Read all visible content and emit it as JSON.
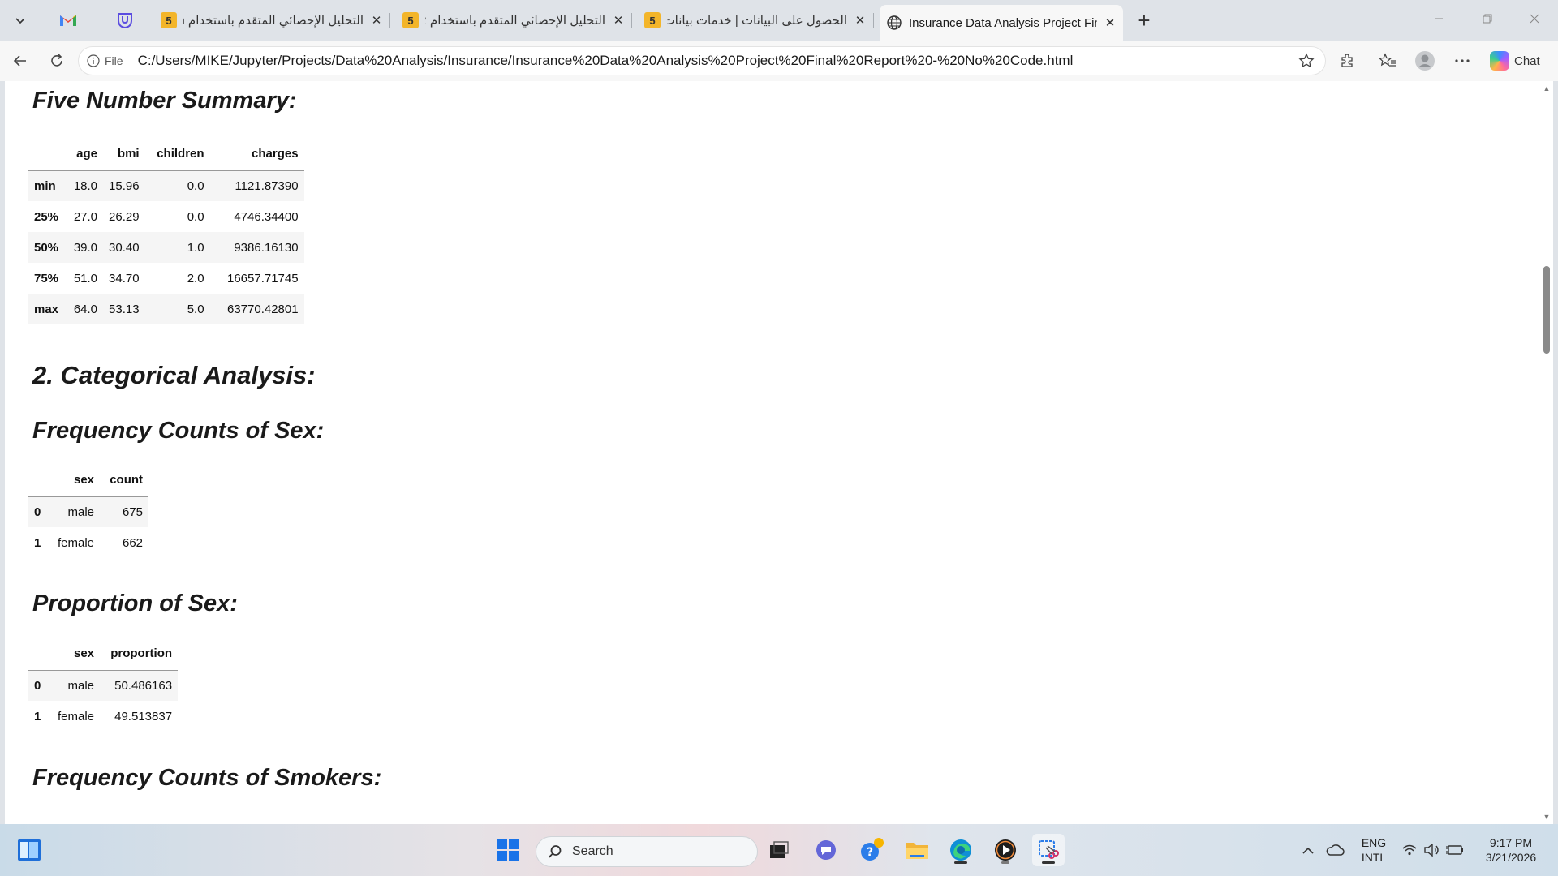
{
  "browser": {
    "tabs": [
      {
        "title": "التحليل الإحصائي المتقدم باستخدام n",
        "favicon": "5",
        "active": false
      },
      {
        "title": "التحليل الإحصائي المتقدم باستخدام R",
        "favicon": "5",
        "active": false
      },
      {
        "title": "الحصول على البيانات | خدمات بيانات",
        "favicon": "5",
        "active": false
      },
      {
        "title": "Insurance Data Analysis Project Final Report - No Code",
        "favicon": "globe-icon",
        "active": true
      }
    ],
    "address": {
      "scheme_label": "File",
      "url": "C:/Users/MIKE/Jupyter/Projects/Data%20Analysis/Insurance/Insurance%20Data%20Analysis%20Project%20Final%20Report%20-%20No%20Code.html"
    },
    "chat_label": "Chat"
  },
  "page": {
    "five_number": {
      "heading": "Five Number Summary:",
      "columns": [
        "",
        "age",
        "bmi",
        "children",
        "charges"
      ],
      "rows": [
        {
          "label": "min",
          "values": [
            "18.0",
            "15.96",
            "0.0",
            "1121.87390"
          ]
        },
        {
          "label": "25%",
          "values": [
            "27.0",
            "26.29",
            "0.0",
            "4746.34400"
          ]
        },
        {
          "label": "50%",
          "values": [
            "39.0",
            "30.40",
            "1.0",
            "9386.16130"
          ]
        },
        {
          "label": "75%",
          "values": [
            "51.0",
            "34.70",
            "2.0",
            "16657.71745"
          ]
        },
        {
          "label": "max",
          "values": [
            "64.0",
            "53.13",
            "5.0",
            "63770.42801"
          ]
        }
      ]
    },
    "categorical_heading": "2. Categorical Analysis:",
    "sex_counts": {
      "heading": "Frequency Counts of Sex:",
      "columns": [
        "",
        "sex",
        "count"
      ],
      "rows": [
        {
          "label": "0",
          "values": [
            "male",
            "675"
          ]
        },
        {
          "label": "1",
          "values": [
            "female",
            "662"
          ]
        }
      ]
    },
    "sex_proportion": {
      "heading": "Proportion of Sex:",
      "columns": [
        "",
        "sex",
        "proportion"
      ],
      "rows": [
        {
          "label": "0",
          "values": [
            "male",
            "50.486163"
          ]
        },
        {
          "label": "1",
          "values": [
            "female",
            "49.513837"
          ]
        }
      ]
    },
    "smokers_heading": "Frequency Counts of Smokers:"
  },
  "taskbar": {
    "search_label": "Search",
    "lang_line1": "ENG",
    "lang_line2": "INTL",
    "time": "9:17 PM",
    "date": "3/21/2026"
  }
}
